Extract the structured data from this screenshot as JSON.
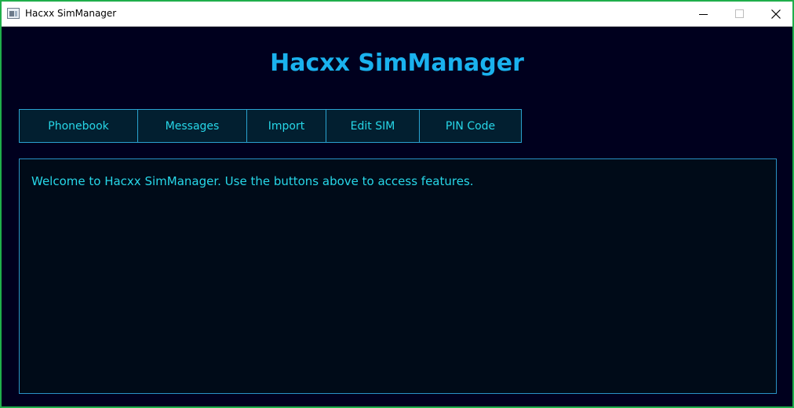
{
  "window": {
    "title": "Hacxx SimManager",
    "controls": {
      "minimize_icon": "minimize-icon",
      "maximize_icon": "maximize-icon",
      "close_icon": "close-icon"
    }
  },
  "header": {
    "title": "Hacxx SimManager"
  },
  "toolbar": {
    "buttons": [
      {
        "label": "Phonebook"
      },
      {
        "label": "Messages"
      },
      {
        "label": "Import"
      },
      {
        "label": "Edit SIM"
      },
      {
        "label": "PIN Code"
      }
    ]
  },
  "main": {
    "message": "Welcome to Hacxx SimManager. Use the buttons above to access features."
  },
  "colors": {
    "window_border": "#1fae4b",
    "background": "#00001e",
    "heading": "#1ab2ee",
    "accent_text": "#27d7e8",
    "button_border": "#2aa3d0",
    "button_bg": "#021f30",
    "panel_bg": "#000b18"
  }
}
